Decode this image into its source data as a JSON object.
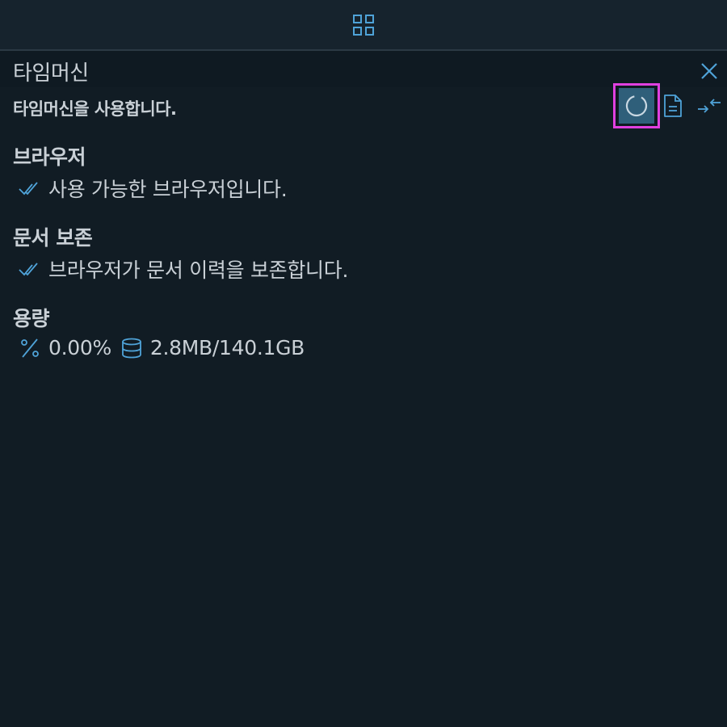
{
  "topbar": {
    "menu_icon": "grid-icon"
  },
  "panel": {
    "title": "타임머신",
    "close_icon": "close-icon",
    "status": "타임머신을 사용합니다.",
    "toolbar": [
      {
        "name": "refresh-button",
        "icon": "circular-progress-icon",
        "active": true
      },
      {
        "name": "log-button",
        "icon": "document-icon",
        "active": false
      },
      {
        "name": "collapse-button",
        "icon": "collapse-arrows-icon",
        "active": false
      }
    ]
  },
  "sections": {
    "browser": {
      "title": "브라우저",
      "status_text": "사용 가능한 브라우저입니다.",
      "status_icon": "double-check-icon"
    },
    "doc_preserve": {
      "title": "문서 보존",
      "status_text": "브라우저가 문서 이력을 보존합니다.",
      "status_icon": "double-check-icon"
    },
    "capacity": {
      "title": "용량",
      "percent_text": "0.00%",
      "percent_icon": "percent-icon",
      "usage_text": "2.8MB/140.1GB",
      "usage_icon": "database-icon"
    }
  },
  "colors": {
    "background": "#111c24",
    "accent": "#4fa3d8",
    "highlight_border": "#e040e0",
    "active_button": "#2f5f7a"
  }
}
